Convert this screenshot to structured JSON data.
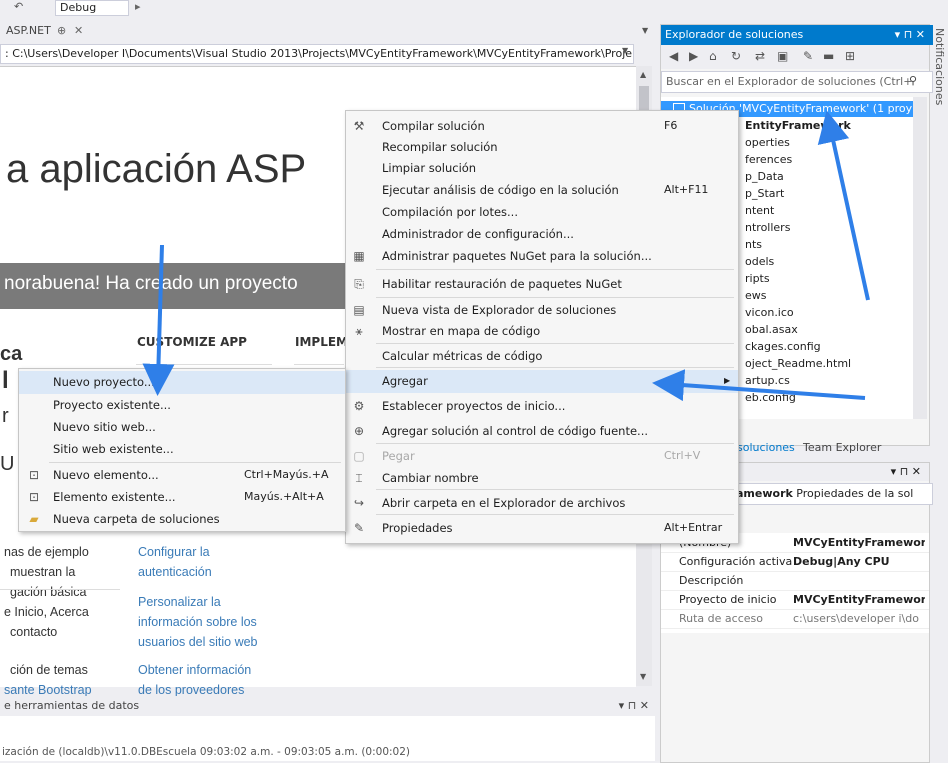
{
  "toolbar": {
    "config": "Debug"
  },
  "doc_tab": {
    "label": "ASP.NET",
    "pin": "⊕",
    "close": "✕"
  },
  "address": "C:\\Users\\Developer I\\Documents\\Visual Studio 2013\\Projects\\MVCyEntityFramework\\MVCyEntityFramework\\Proje",
  "page": {
    "title": "a aplicación ASP",
    "banner": "norabuena! Ha creado un proyecto",
    "left_heading": "ca",
    "left_heading2": "l",
    "left_heading3": "r",
    "col_customize": "CUSTOMIZE APP",
    "col_implement": "IMPLEM",
    "left_lines": [
      "nas de ejemplo",
      "muestran la",
      "gación básica",
      "e Inicio, Acerca",
      "contacto",
      "",
      "ción de temas",
      "sante Bootstrap"
    ],
    "links": [
      "Configurar la",
      "autenticación",
      "Personalizar la",
      "información sobre los",
      "usuarios del sitio web",
      "Obtener información",
      "de los proveedores"
    ]
  },
  "data_tools": {
    "label": "e herramientas de datos",
    "controls": "▾ ⊓ ✕"
  },
  "output": {
    "line": "ización de (localdb)\\v11.0.DBEscuela   09:03:02 a.m. - 09:03:05 a.m. (0:00:02)"
  },
  "solution_explorer": {
    "title": "Explorador de soluciones",
    "controls": "▾ ⊓ ✕",
    "search_placeholder": "Buscar en el Explorador de soluciones (Ctrl+",
    "selected": "Solución 'MVCyEntityFramework' (1 proy",
    "project": "EntityFramework",
    "items": [
      "operties",
      "ferences",
      "p_Data",
      "p_Start",
      "ntent",
      "ntrollers",
      "nts",
      "odels",
      "ripts",
      "ews",
      "vicon.ico",
      "obal.asax",
      "ckages.config",
      "oject_Readme.html",
      "artup.cs",
      "eb.config"
    ],
    "tab_solutions": "soluciones",
    "tab_team": "Team Explorer"
  },
  "notifications": "Notificaciones",
  "properties": {
    "controls": "▾ ⊓ ✕",
    "combo_bold": "amework",
    "combo_rest": " Propiedades de la sol",
    "rows": [
      {
        "key": "(Nombre)",
        "value": "MVCyEntityFramework",
        "bold": true
      },
      {
        "key": "Configuración activa",
        "value": "Debug|Any CPU",
        "bold": true
      },
      {
        "key": "Descripción",
        "value": ""
      },
      {
        "key": "Proyecto de inicio",
        "value": "MVCyEntityFramework",
        "bold": true
      },
      {
        "key": "Ruta de acceso",
        "value": "c:\\users\\developer i\\do"
      }
    ]
  },
  "main_menu": [
    {
      "label": "Compilar solución",
      "shortcut": "F6",
      "icon": "build-icon"
    },
    {
      "label": "Recompilar solución"
    },
    {
      "label": "Limpiar solución"
    },
    {
      "label": "Ejecutar análisis de código en la solución",
      "shortcut": "Alt+F11"
    },
    {
      "label": "Compilación por lotes..."
    },
    {
      "label": "Administrador de configuración..."
    },
    {
      "label": "Administrar paquetes NuGet para la solución...",
      "icon": "nuget-icon"
    },
    {
      "label": "Habilitar restauración de paquetes NuGet",
      "icon": "restore-icon"
    },
    {
      "label": "Nueva vista de Explorador de soluciones",
      "icon": "new-view-icon"
    },
    {
      "label": "Mostrar en mapa de código",
      "icon": "code-map-icon"
    },
    {
      "label": "Calcular métricas de código"
    },
    {
      "label": "Agregar",
      "submenu": true
    },
    {
      "label": "Establecer proyectos de inicio...",
      "icon": "gear-icon"
    },
    {
      "label": "Agregar solución al control de código fuente...",
      "icon": "source-control-icon"
    },
    {
      "label": "Pegar",
      "shortcut": "Ctrl+V",
      "icon": "paste-icon",
      "disabled": true
    },
    {
      "label": "Cambiar nombre",
      "icon": "rename-icon"
    },
    {
      "label": "Abrir carpeta en el Explorador de archivos",
      "icon": "open-folder-icon"
    },
    {
      "label": "Propiedades",
      "shortcut": "Alt+Entrar",
      "icon": "wrench-icon"
    }
  ],
  "sub_menu": [
    {
      "label": "Nuevo proyecto..."
    },
    {
      "label": "Proyecto existente..."
    },
    {
      "label": "Nuevo sitio web..."
    },
    {
      "label": "Sitio web existente..."
    },
    {
      "label": "Nuevo elemento...",
      "shortcut": "Ctrl+Mayús.+A",
      "icon": "new-item-icon"
    },
    {
      "label": "Elemento existente...",
      "shortcut": "Mayús.+Alt+A",
      "icon": "existing-item-icon"
    },
    {
      "label": "Nueva carpeta de soluciones",
      "icon": "folder-icon"
    }
  ],
  "colors": {
    "accent": "#007acc",
    "selection": "#3399ff",
    "arrow": "#2f7fe8",
    "banner": "#7a7a7a",
    "link": "#3a7bb7"
  }
}
